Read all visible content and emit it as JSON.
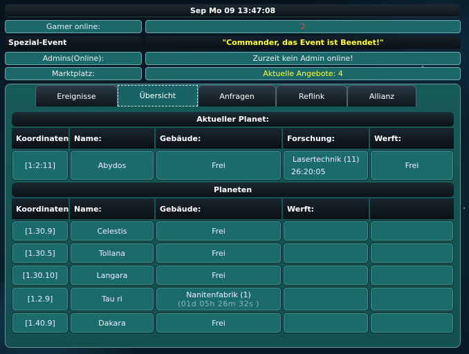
{
  "header": {
    "datetime": "Sep Mo 09 13:47:08"
  },
  "info": {
    "gamer_online_label": "Gamer online:",
    "gamer_online_value": "2",
    "event_label": "Spezial-Event",
    "event_value": "\"Commander, das Event ist Beendet!\"",
    "admins_label": "Admins(Online):",
    "admins_value": "Zurzeit kein Admin online!",
    "market_label": "Marktplatz:",
    "market_value": "Aktuelle Angebote: 4"
  },
  "tabs": [
    {
      "label": "Ereignisse"
    },
    {
      "label": "Übersicht"
    },
    {
      "label": "Anfragen"
    },
    {
      "label": "Reflink"
    },
    {
      "label": "Allianz"
    }
  ],
  "current_planet": {
    "title": "Aktueller Planet:",
    "headers": {
      "coords": "Koordinaten",
      "name": "Name:",
      "buildings": "Gebäude:",
      "research": "Forschung:",
      "shipyard": "Werft:"
    },
    "row": {
      "coords": "[1:2:11]",
      "name": "Abydos",
      "buildings": "Frei",
      "research": "Lasertechnik (11)",
      "research_time": "26:20:05",
      "shipyard": "Frei"
    }
  },
  "planets": {
    "title": "Planeten",
    "headers": {
      "coords": "Koordinaten",
      "name": "Name:",
      "buildings": "Gebäude:",
      "shipyard": "Werft:",
      "extra": ""
    },
    "rows": [
      {
        "coords": "[1.30.9]",
        "name": "Celestis",
        "buildings": "Frei",
        "buildings_sub": "",
        "shipyard": "",
        "extra": ""
      },
      {
        "coords": "[1.30.5]",
        "name": "Tollana",
        "buildings": "Frei",
        "buildings_sub": "",
        "shipyard": "",
        "extra": ""
      },
      {
        "coords": "[1.30.10]",
        "name": "Langara",
        "buildings": "Frei",
        "buildings_sub": "",
        "shipyard": "",
        "extra": ""
      },
      {
        "coords": "[1.2.9]",
        "name": "Tau ri",
        "buildings": "Nanitenfabrik (1)",
        "buildings_sub": "(01d 05h 26m 32s )",
        "shipyard": "",
        "extra": ""
      },
      {
        "coords": "[1.40.9]",
        "name": "Dakara",
        "buildings": "Frei",
        "buildings_sub": "",
        "shipyard": "",
        "extra": ""
      }
    ]
  },
  "colors": {
    "accent_teal": "#1c6b6b",
    "highlight_yellow": "#ffff33",
    "alert_red": "#ff4040"
  }
}
